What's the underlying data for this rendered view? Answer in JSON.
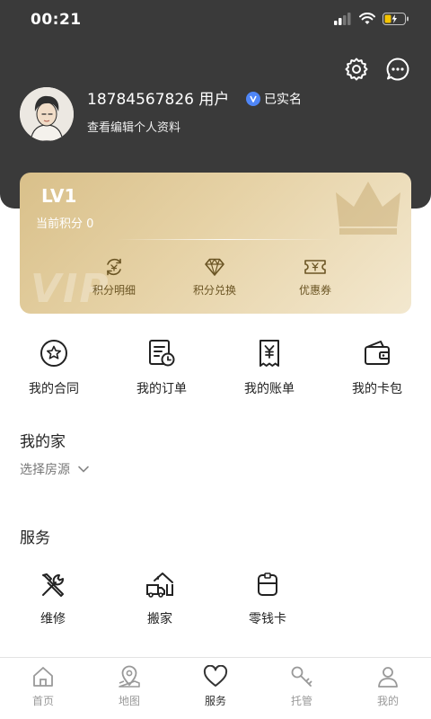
{
  "status_bar": {
    "time": "00:21"
  },
  "header": {
    "settings_icon": "gear-icon",
    "messages_icon": "chat-bubble-icon"
  },
  "profile": {
    "phone_user": "18784567826 用户",
    "verified_label": "已实名",
    "edit_profile_label": "查看编辑个人资料"
  },
  "vip": {
    "level": "LV1",
    "points_label": "当前积分 0",
    "watermark": "VIP",
    "actions": [
      {
        "label": "积分明细",
        "icon": "points-detail-icon"
      },
      {
        "label": "积分兑换",
        "icon": "diamond-icon"
      },
      {
        "label": "优惠券",
        "icon": "coupon-icon"
      }
    ]
  },
  "quick_links": [
    {
      "label": "我的合同",
      "icon": "contract-icon"
    },
    {
      "label": "我的订单",
      "icon": "order-icon"
    },
    {
      "label": "我的账单",
      "icon": "bill-icon"
    },
    {
      "label": "我的卡包",
      "icon": "wallet-icon"
    }
  ],
  "home": {
    "title": "我的家",
    "selector_label": "选择房源"
  },
  "services": {
    "title": "服务",
    "items": [
      {
        "label": "维修",
        "icon": "repair-tools-icon"
      },
      {
        "label": "搬家",
        "icon": "moving-truck-icon"
      },
      {
        "label": "零钱卡",
        "icon": "change-card-icon"
      }
    ]
  },
  "tab_bar": {
    "tabs": [
      {
        "label": "首页",
        "icon": "home-icon",
        "active": false
      },
      {
        "label": "地图",
        "icon": "map-pin-icon",
        "active": false
      },
      {
        "label": "服务",
        "icon": "heart-icon",
        "active": true
      },
      {
        "label": "托管",
        "icon": "key-icon",
        "active": false
      },
      {
        "label": "我的",
        "icon": "person-icon",
        "active": false
      }
    ]
  },
  "colors": {
    "header_bg": "#3a3a3a",
    "vip_gold": "#d9c08a",
    "verified_blue": "#4f86f7"
  }
}
